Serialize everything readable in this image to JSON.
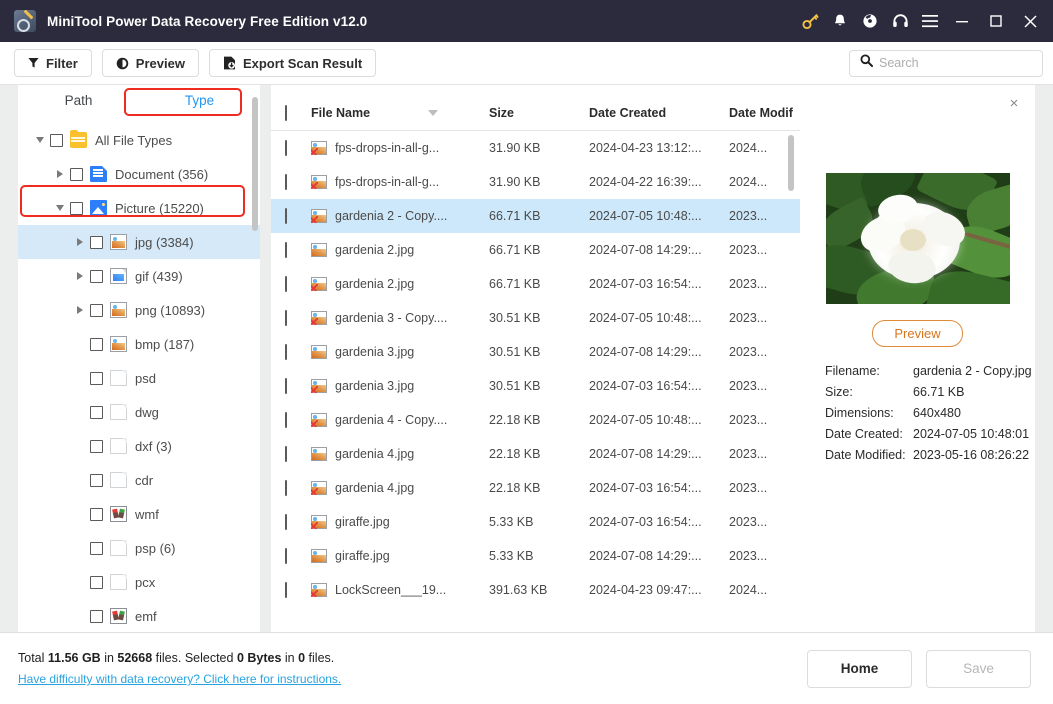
{
  "titlebar": {
    "title": "MiniTool Power Data Recovery Free Edition v12.0",
    "icons": [
      "key-icon",
      "bell-icon",
      "disc-icon",
      "headset-icon",
      "hamburger-menu-icon",
      "minimize-icon",
      "maximize-icon",
      "close-icon"
    ]
  },
  "toolbar": {
    "filter_label": "Filter",
    "preview_label": "Preview",
    "export_label": "Export Scan Result"
  },
  "search": {
    "placeholder": "Search",
    "value": ""
  },
  "sidebar": {
    "tabs": [
      {
        "label": "Path",
        "active": false
      },
      {
        "label": "Type",
        "active": true
      }
    ],
    "tree": [
      {
        "label": "All File Types",
        "indent": 0,
        "twisty": "down",
        "icon": "folder-icon",
        "selected": false
      },
      {
        "label": "Document (356)",
        "indent": 1,
        "twisty": "right",
        "icon": "document-icon",
        "selected": false
      },
      {
        "label": "Picture (15220)",
        "indent": 1,
        "twisty": "down",
        "icon": "picture-icon",
        "selected": false
      },
      {
        "label": "jpg (3384)",
        "indent": 2,
        "twisty": "right",
        "icon": "image-file-icon",
        "selected": true
      },
      {
        "label": "gif (439)",
        "indent": 2,
        "twisty": "right",
        "icon": "gif-file-icon",
        "selected": false
      },
      {
        "label": "png (10893)",
        "indent": 2,
        "twisty": "right",
        "icon": "image-file-icon",
        "selected": false
      },
      {
        "label": "bmp (187)",
        "indent": 2,
        "twisty": "none",
        "icon": "image-file-icon",
        "selected": false
      },
      {
        "label": "psd",
        "indent": 2,
        "twisty": "none",
        "icon": "blank-file-icon",
        "selected": false
      },
      {
        "label": "dwg",
        "indent": 2,
        "twisty": "none",
        "icon": "blank-file-icon",
        "selected": false
      },
      {
        "label": "dxf (3)",
        "indent": 2,
        "twisty": "none",
        "icon": "blank-file-icon",
        "selected": false
      },
      {
        "label": "cdr",
        "indent": 2,
        "twisty": "none",
        "icon": "blank-file-icon",
        "selected": false
      },
      {
        "label": "wmf",
        "indent": 2,
        "twisty": "none",
        "icon": "metafile-icon",
        "selected": false
      },
      {
        "label": "psp (6)",
        "indent": 2,
        "twisty": "none",
        "icon": "blank-file-icon",
        "selected": false
      },
      {
        "label": "pcx",
        "indent": 2,
        "twisty": "none",
        "icon": "blank-file-icon",
        "selected": false
      },
      {
        "label": "emf",
        "indent": 2,
        "twisty": "none",
        "icon": "metafile-icon",
        "selected": false
      }
    ]
  },
  "filelist": {
    "columns": [
      "File Name",
      "Size",
      "Date Created",
      "Date Modif"
    ],
    "sorted_by": "File Name",
    "rows": [
      {
        "name": "fps-drops-in-all-g...",
        "size": "31.90 KB",
        "created": "2024-04-23 13:12:...",
        "modified": "2024...",
        "deleted": true,
        "selected": false
      },
      {
        "name": "fps-drops-in-all-g...",
        "size": "31.90 KB",
        "created": "2024-04-22 16:39:...",
        "modified": "2024...",
        "deleted": true,
        "selected": false
      },
      {
        "name": "gardenia 2 - Copy....",
        "size": "66.71 KB",
        "created": "2024-07-05 10:48:...",
        "modified": "2023...",
        "deleted": true,
        "selected": true
      },
      {
        "name": "gardenia 2.jpg",
        "size": "66.71 KB",
        "created": "2024-07-08 14:29:...",
        "modified": "2023...",
        "deleted": false,
        "selected": false
      },
      {
        "name": "gardenia 2.jpg",
        "size": "66.71 KB",
        "created": "2024-07-03 16:54:...",
        "modified": "2023...",
        "deleted": true,
        "selected": false
      },
      {
        "name": "gardenia 3 - Copy....",
        "size": "30.51 KB",
        "created": "2024-07-05 10:48:...",
        "modified": "2023...",
        "deleted": true,
        "selected": false
      },
      {
        "name": "gardenia 3.jpg",
        "size": "30.51 KB",
        "created": "2024-07-08 14:29:...",
        "modified": "2023...",
        "deleted": false,
        "selected": false
      },
      {
        "name": "gardenia 3.jpg",
        "size": "30.51 KB",
        "created": "2024-07-03 16:54:...",
        "modified": "2023...",
        "deleted": true,
        "selected": false
      },
      {
        "name": "gardenia 4 - Copy....",
        "size": "22.18 KB",
        "created": "2024-07-05 10:48:...",
        "modified": "2023...",
        "deleted": true,
        "selected": false
      },
      {
        "name": "gardenia 4.jpg",
        "size": "22.18 KB",
        "created": "2024-07-08 14:29:...",
        "modified": "2023...",
        "deleted": false,
        "selected": false
      },
      {
        "name": "gardenia 4.jpg",
        "size": "22.18 KB",
        "created": "2024-07-03 16:54:...",
        "modified": "2023...",
        "deleted": true,
        "selected": false
      },
      {
        "name": "giraffe.jpg",
        "size": "5.33 KB",
        "created": "2024-07-03 16:54:...",
        "modified": "2023...",
        "deleted": true,
        "selected": false
      },
      {
        "name": "giraffe.jpg",
        "size": "5.33 KB",
        "created": "2024-07-08 14:29:...",
        "modified": "2023...",
        "deleted": false,
        "selected": false
      },
      {
        "name": "LockScreen___19...",
        "size": "391.63 KB",
        "created": "2024-04-23 09:47:...",
        "modified": "2024...",
        "deleted": true,
        "selected": false
      }
    ]
  },
  "preview": {
    "close_label": "×",
    "image_alt": "gardenia white flower photo",
    "button_label": "Preview",
    "meta": [
      {
        "key": "Filename:",
        "value": "gardenia 2 - Copy.jpg"
      },
      {
        "key": "Size:",
        "value": "66.71 KB"
      },
      {
        "key": "Dimensions:",
        "value": "640x480"
      },
      {
        "key": "Date Created:",
        "value": "2024-07-05 10:48:01"
      },
      {
        "key": "Date Modified:",
        "value": "2023-05-16 08:26:22"
      }
    ]
  },
  "status": {
    "total_prefix": "Total ",
    "total_size": "11.56 GB",
    "total_mid": " in ",
    "total_files": "52668",
    "total_suffix": " files.  Selected ",
    "selected_size": "0 Bytes",
    "selected_mid": " in ",
    "selected_files": "0",
    "selected_suffix": " files.",
    "help_link": "Have difficulty with data recovery? Click here for instructions.",
    "home_label": "Home",
    "save_label": "Save"
  },
  "colors": {
    "titlebar_bg": "#2b2b3d",
    "accent_blue": "#2196f3",
    "row_selected": "#cde8fa",
    "tree_selected": "#d5e9f8",
    "annotation_red": "#ef2b1f",
    "preview_btn": "#d4761e",
    "link": "#29a3e0"
  }
}
